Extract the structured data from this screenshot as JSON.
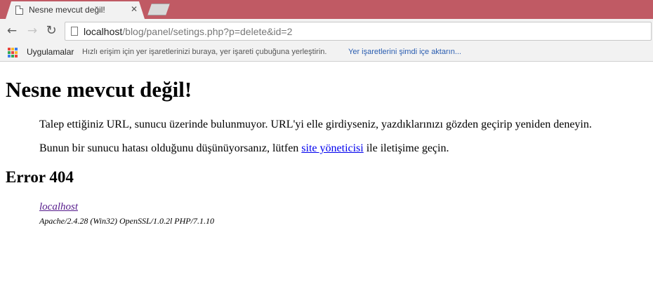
{
  "tab": {
    "title": "Nesne mevcut değil!",
    "close_glyph": "✕"
  },
  "nav": {
    "back_glyph": "←",
    "forward_glyph": "→",
    "reload_glyph": "↻"
  },
  "omnibox": {
    "host": "localhost",
    "path": "/blog/panel/setings.php?p=delete&id=2"
  },
  "bookmarks": {
    "apps_label": "Uygulamalar",
    "apps_colors": [
      "#e8453c",
      "#f9bb2d",
      "#3b7ded",
      "#34a853",
      "#e8453c",
      "#f9bb2d",
      "#3b7ded",
      "#34a853",
      "#e8453c"
    ],
    "hint": "Hızlı erişim için yer işaretlerinizi buraya, yer işareti çubuğuna yerleştirin.",
    "import_link": "Yer işaretlerini şimdi içe aktarın..."
  },
  "page": {
    "title": "Nesne mevcut değil!",
    "paragraph1": "Talep ettiğiniz URL, sunucu üzerinde bulunmuyor. URL'yi elle girdiyseniz, yazdıklarınızı gözden geçirip yeniden deneyin.",
    "paragraph2_before": "Bunun bir sunucu hatası olduğunu düşünüyorsanız, lütfen ",
    "paragraph2_link": "site yöneticisi",
    "paragraph2_after": " ile iletişime geçin.",
    "error_code": "Error 404",
    "address_link": "localhost",
    "server_signature": "Apache/2.4.28 (Win32) OpenSSL/1.0.2l PHP/7.1.10"
  },
  "colors": {
    "titlebar": "#c05a64",
    "link": "#0000ee",
    "visited_link": "#551a8b",
    "bookmark_link": "#2a5db0"
  }
}
